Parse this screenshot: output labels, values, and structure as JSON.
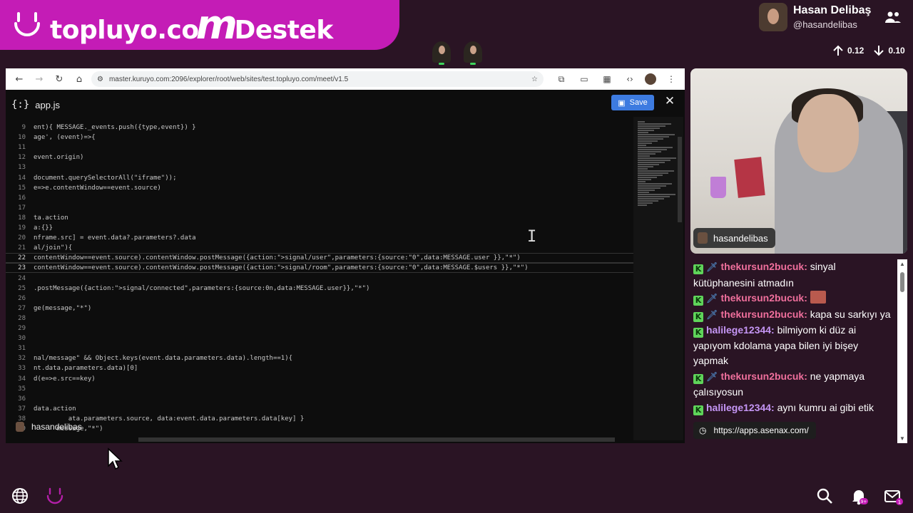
{
  "banner": {
    "brand_left": "topluyo.co",
    "brand_mid": "m",
    "brand_right": "Destek"
  },
  "user": {
    "name": "Hasan Delibaş",
    "handle": "@hasandelibas"
  },
  "network": {
    "upload": "0.12",
    "download": "0.10"
  },
  "browser": {
    "url": "master.kuruyo.com:2096/explorer/root/web/sites/test.topluyo.com/meet/v1.5"
  },
  "editor": {
    "filename": "app.js",
    "save_label": "Save",
    "close_label": "✕",
    "lines": [
      {
        "n": "9",
        "t": "ent){ MESSAGE._events.push({type,event}) }"
      },
      {
        "n": "10",
        "t": "age', (event)=>{"
      },
      {
        "n": "11",
        "t": ""
      },
      {
        "n": "12",
        "t": "event.origin)"
      },
      {
        "n": "13",
        "t": ""
      },
      {
        "n": "14",
        "t": "document.querySelectorAll(\"iframe\"));"
      },
      {
        "n": "15",
        "t": "e=>e.contentWindow==event.source)"
      },
      {
        "n": "16",
        "t": ""
      },
      {
        "n": "17",
        "t": ""
      },
      {
        "n": "18",
        "t": "ta.action"
      },
      {
        "n": "19",
        "t": "a:{}}"
      },
      {
        "n": "20",
        "t": "nframe.src] = event.data?.parameters?.data"
      },
      {
        "n": "21",
        "t": "al/join\"){"
      },
      {
        "n": "22",
        "t": "contentWindow==event.source).contentWindow.postMessage({action:\">signal/user\",parameters:{source:\"0\",data:MESSAGE.user }},\"*\")"
      },
      {
        "n": "23",
        "t": "contentWindow==event.source).contentWindow.postMessage({action:\">signal/room\",parameters:{source:\"0\",data:MESSAGE.$users }},\"*\")"
      },
      {
        "n": "24",
        "t": ""
      },
      {
        "n": "25",
        "t": ".postMessage({action:\">signal/connected\",parameters:{source:0n,data:MESSAGE.user}},\"*\")"
      },
      {
        "n": "26",
        "t": ""
      },
      {
        "n": "27",
        "t": "ge(message,\"*\")"
      },
      {
        "n": "28",
        "t": ""
      },
      {
        "n": "29",
        "t": ""
      },
      {
        "n": "30",
        "t": ""
      },
      {
        "n": "31",
        "t": ""
      },
      {
        "n": "32",
        "t": "nal/message\" && Object.keys(event.data.parameters.data).length==1){"
      },
      {
        "n": "33",
        "t": "nt.data.parameters.data)[0]"
      },
      {
        "n": "34",
        "t": "d(e=>e.src==key)"
      },
      {
        "n": "35",
        "t": ""
      },
      {
        "n": "36",
        "t": ""
      },
      {
        "n": "37",
        "t": "data.action"
      },
      {
        "n": "38",
        "t": "         ata.parameters.source, data:event.data.parameters.data[key] }"
      },
      {
        "n": "39",
        "t": "      message,\"*\")"
      }
    ],
    "bottom_user": "hasandelibas"
  },
  "webcam": {
    "label": "hasandelibas"
  },
  "chat": {
    "messages": [
      {
        "user": "thekursun2bucuk",
        "text": "sinyal kütüphanesini atmadın",
        "sword": true,
        "cls": "u1"
      },
      {
        "user": "thekursun2bucuk",
        "text": "",
        "sword": true,
        "cls": "u1",
        "emote": true
      },
      {
        "user": "thekursun2bucuk",
        "text": "kapa su sarkıyı ya",
        "sword": true,
        "cls": "u1"
      },
      {
        "user": "halilege12344",
        "text": "bilmiyom ki düz ai yapıyom kdolama yapa bilen iyi bişey yapmak",
        "sword": false,
        "cls": "u2"
      },
      {
        "user": "thekursun2bucuk",
        "text": "ne yapmaya çalısıyosun",
        "sword": true,
        "cls": "u1"
      },
      {
        "user": "halilege12344",
        "text": "aynı kumru ai gibi etik",
        "sword": false,
        "cls": "u2"
      }
    ],
    "link_tooltip": "https://apps.asenax.com/"
  },
  "colors": {
    "brand": "#c41cb6",
    "save": "#3d7be0",
    "badge_k": "#5fd35a"
  },
  "icons": [
    "globe-icon",
    "topluyo-logo-icon",
    "search-icon",
    "bell-icon",
    "mail-icon",
    "people-icon"
  ],
  "notifications": {
    "bell_badge": "9+",
    "mail_badge": "1"
  }
}
